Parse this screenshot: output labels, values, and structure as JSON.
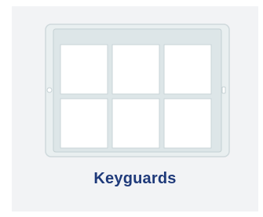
{
  "category_card": {
    "label": "Keyguards",
    "icon": "keyguard-tablet-icon",
    "accent_color": "#1f3a7a",
    "background_color": "#f2f3f5",
    "keyguard_grid": {
      "rows": 2,
      "columns": 3
    }
  }
}
